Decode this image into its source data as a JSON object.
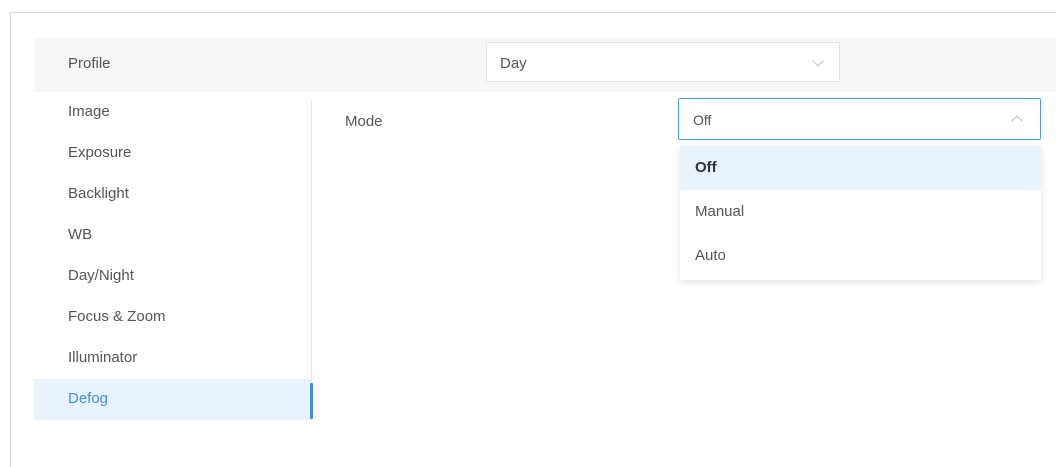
{
  "profile": {
    "label": "Profile",
    "value": "Day"
  },
  "menu": {
    "items": [
      {
        "label": "Image"
      },
      {
        "label": "Exposure"
      },
      {
        "label": "Backlight"
      },
      {
        "label": "WB"
      },
      {
        "label": "Day/Night"
      },
      {
        "label": "Focus & Zoom"
      },
      {
        "label": "Illuminator"
      },
      {
        "label": "Defog"
      }
    ],
    "active": "Defog"
  },
  "mode": {
    "label": "Mode",
    "value": "Off",
    "options": [
      {
        "label": "Off"
      },
      {
        "label": "Manual"
      },
      {
        "label": "Auto"
      }
    ],
    "selected": "Off"
  },
  "colors": {
    "accent": "#3d8fe3",
    "active_bg": "#e8f3fd",
    "row_bg": "#f7f7f7"
  },
  "icons": {
    "profile_select": "chevron-down-icon",
    "mode_select": "chevron-up-icon"
  }
}
